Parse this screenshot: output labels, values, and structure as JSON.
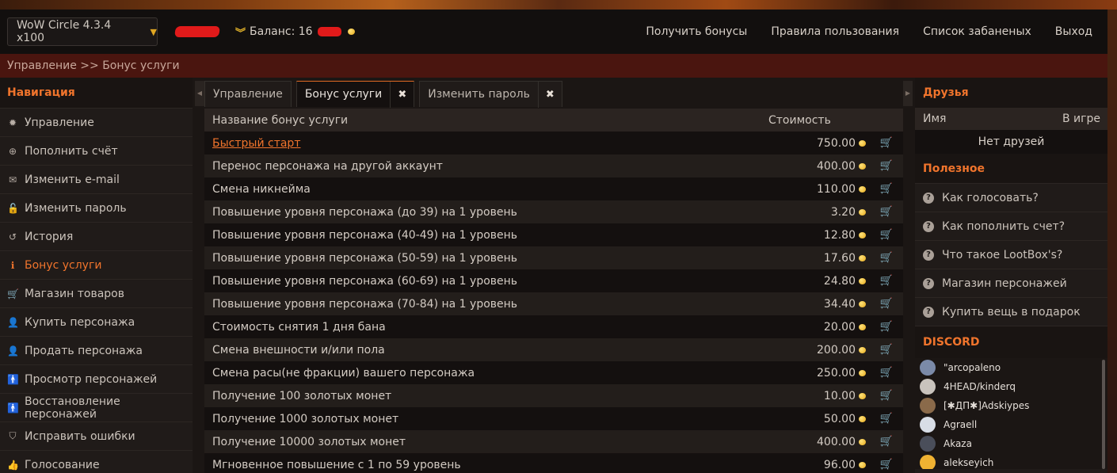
{
  "header": {
    "server": "WoW Circle 4.3.4 x100",
    "balance_label": "Баланс: 16",
    "nav": [
      "Получить бонусы",
      "Правила пользования",
      "Список забаненых",
      "Выход"
    ]
  },
  "breadcrumb": "Управление >> Бонус услуги",
  "left_nav": {
    "title": "Навигация",
    "items": [
      {
        "icon": "gear-icon",
        "glyph": "✹",
        "label": "Управление"
      },
      {
        "icon": "plus-circle-icon",
        "glyph": "⊕",
        "label": "Пополнить счёт"
      },
      {
        "icon": "envelope-icon",
        "glyph": "✉",
        "label": "Изменить e-mail"
      },
      {
        "icon": "lock-icon",
        "glyph": "🔓",
        "label": "Изменить пароль"
      },
      {
        "icon": "history-icon",
        "glyph": "↺",
        "label": "История"
      },
      {
        "icon": "info-icon",
        "glyph": "ℹ",
        "label": "Бонус услуги",
        "active": true
      },
      {
        "icon": "cart-icon",
        "glyph": "🛒",
        "label": "Магазин товаров"
      },
      {
        "icon": "user-icon",
        "glyph": "👤",
        "label": "Купить персонажа"
      },
      {
        "icon": "user-icon",
        "glyph": "👤",
        "label": "Продать персонажа"
      },
      {
        "icon": "male-icon",
        "glyph": "🚹",
        "label": "Просмотр персонажей"
      },
      {
        "icon": "male-icon",
        "glyph": "🚹",
        "label": "Восстановление персонажей"
      },
      {
        "icon": "shield-icon",
        "glyph": "⛉",
        "label": "Исправить ошибки"
      },
      {
        "icon": "thumbs-up-icon",
        "glyph": "👍",
        "label": "Голосование"
      }
    ]
  },
  "tabs": [
    {
      "label": "Управление",
      "closable": false,
      "active": false
    },
    {
      "label": "Бонус услуги",
      "closable": true,
      "active": true
    },
    {
      "label": "Изменить пароль",
      "closable": true,
      "active": false
    }
  ],
  "table": {
    "headers": {
      "name": "Название бонус услуги",
      "price": "Стоимость"
    },
    "rows": [
      {
        "name": "Быстрый старт",
        "price": "750.00",
        "link": true
      },
      {
        "name": "Перенос персонажа на другой аккаунт",
        "price": "400.00"
      },
      {
        "name": "Смена никнейма",
        "price": "110.00"
      },
      {
        "name": "Повышение уровня персонажа (до 39) на 1 уровень",
        "price": "3.20"
      },
      {
        "name": "Повышение уровня персонажа (40-49) на 1 уровень",
        "price": "12.80"
      },
      {
        "name": "Повышение уровня персонажа (50-59) на 1 уровень",
        "price": "17.60"
      },
      {
        "name": "Повышение уровня персонажа (60-69) на 1 уровень",
        "price": "24.80"
      },
      {
        "name": "Повышение уровня персонажа (70-84) на 1 уровень",
        "price": "34.40"
      },
      {
        "name": "Стоимость снятия 1 дня бана",
        "price": "20.00"
      },
      {
        "name": "Смена внешности и/или пола",
        "price": "200.00"
      },
      {
        "name": "Смена расы(не фракции) вашего персонажа",
        "price": "250.00"
      },
      {
        "name": "Получение 100 золотых монет",
        "price": "10.00"
      },
      {
        "name": "Получение 1000 золотых монет",
        "price": "50.00"
      },
      {
        "name": "Получение 10000 золотых монет",
        "price": "400.00"
      },
      {
        "name": "Мгновенное повышение с 1 по 59 уровень",
        "price": "96.00"
      }
    ]
  },
  "friends": {
    "title": "Друзья",
    "col_name": "Имя",
    "col_status": "В игре",
    "empty": "Нет друзей"
  },
  "useful": {
    "title": "Полезное",
    "items": [
      "Как голосовать?",
      "Как пополнить счет?",
      "Что такое LootBox's?",
      "Магазин персонажей",
      "Купить вещь в подарок"
    ]
  },
  "discord": {
    "title": "DISCORD",
    "members": [
      {
        "name": "\"arcopaleno",
        "color": "#7b8aa8"
      },
      {
        "name": "4HEAD/kinderq",
        "color": "#c9c3bd"
      },
      {
        "name": "[✱ДП✱]Adskiypes",
        "color": "#8a6a4a"
      },
      {
        "name": "Agraell",
        "color": "#d8dde6"
      },
      {
        "name": "Akaza",
        "color": "#4a4e5a"
      },
      {
        "name": "alekseyich",
        "color": "#f0b232"
      }
    ]
  },
  "colors": {
    "accent": "#f0742c",
    "breadcrumb_bg": "#4a150f",
    "coin": "#e6a81a"
  }
}
